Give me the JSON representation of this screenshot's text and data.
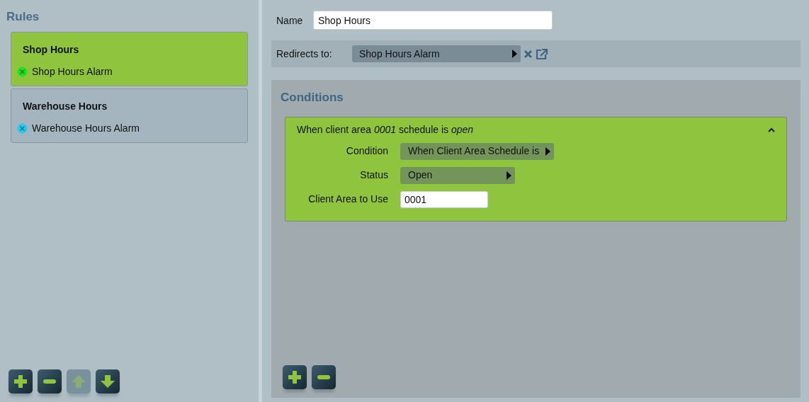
{
  "rules": {
    "title": "Rules",
    "items": [
      {
        "name": "Shop Hours",
        "target": "Shop Hours Alarm",
        "selected": true,
        "color": "#22e022"
      },
      {
        "name": "Warehouse Hours",
        "target": "Warehouse Hours Alarm",
        "selected": false,
        "color": "#22ccee"
      }
    ],
    "toolbar": [
      {
        "kind": "add",
        "disabled": false
      },
      {
        "kind": "remove",
        "disabled": false
      },
      {
        "kind": "up",
        "disabled": true
      },
      {
        "kind": "down",
        "disabled": false
      }
    ]
  },
  "editor": {
    "name_label": "Name",
    "name_value": "Shop Hours",
    "redirect_label": "Redirects to:",
    "redirect_value": "Shop Hours Alarm",
    "conditions_title": "Conditions",
    "conditions": [
      {
        "summary": "When client area *0001* schedule is *open*",
        "expanded": true,
        "fields": [
          {
            "kind": "select",
            "label": "Condition",
            "value": "When Client Area Schedule is"
          },
          {
            "kind": "select",
            "label": "Status",
            "value": "Open"
          },
          {
            "kind": "input",
            "label": "Client Area to Use",
            "value": "0001"
          }
        ]
      }
    ],
    "toolbar": [
      {
        "kind": "add",
        "disabled": false
      },
      {
        "kind": "remove",
        "disabled": false
      }
    ]
  }
}
